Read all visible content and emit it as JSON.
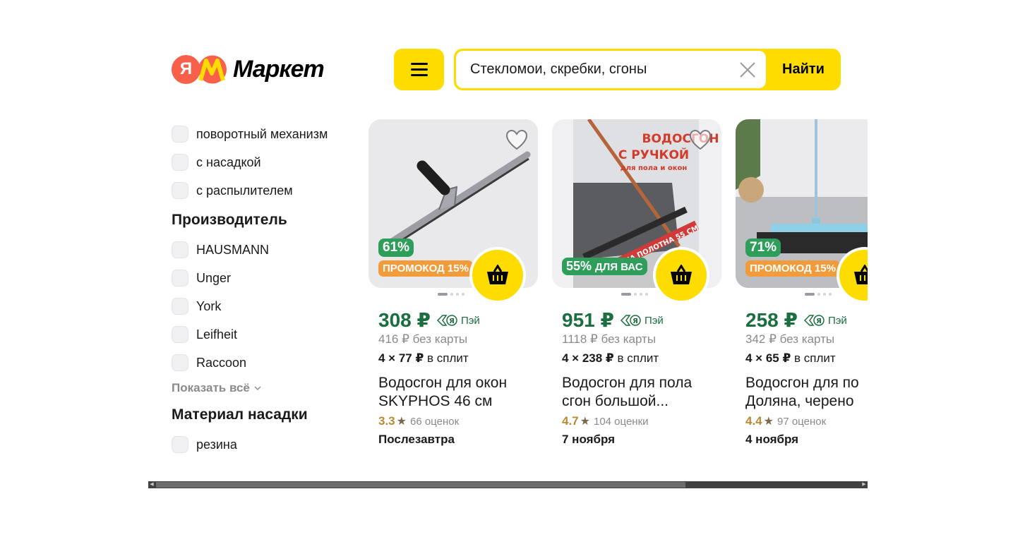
{
  "header": {
    "logo_letter": "Я",
    "logo_text": "Маркет",
    "search_value": "Стекломои, скребки, сгоны",
    "find_label": "Найти"
  },
  "filters": {
    "features": [
      "поворотный механизм",
      "с насадкой",
      "с распылителем"
    ],
    "manufacturer_title": "Производитель",
    "manufacturers": [
      "HAUSMANN",
      "Unger",
      "York",
      "Leifheit",
      "Raccoon"
    ],
    "show_all": "Показать всё",
    "material_title": "Материал насадки",
    "materials": [
      "резина"
    ]
  },
  "products": [
    {
      "discount": "61%",
      "promo": "ПРОМОКОД 15%",
      "price": "308 ₽",
      "pay_label": "Пэй",
      "old_price": "416 ₽ без карты",
      "split_amount": "4 × 77 ₽",
      "split_label": "в сплит",
      "title_line1": "Водосгон для окон",
      "title_line2": "SKYPHOS 46 см",
      "rating": "3.3",
      "reviews": "66 оценок",
      "delivery": "Послезавтра"
    },
    {
      "discount": "55%",
      "discount_note": "ДЛЯ ВАС",
      "image_text_1": "ВОДОСГОН",
      "image_text_2": "С РУЧКОЙ",
      "image_text_3": "для пола и окон",
      "image_text_4": "ШИРИНА ПОЛОТНА 55 СМ",
      "price": "951 ₽",
      "pay_label": "Пэй",
      "old_price": "1118 ₽ без карты",
      "split_amount": "4 × 238 ₽",
      "split_label": "в сплит",
      "title_line1": "Водосгон для пола",
      "title_line2": "сгон большой...",
      "rating": "4.7",
      "reviews": "104 оценки",
      "delivery": "7 ноября"
    },
    {
      "discount": "71%",
      "promo": "ПРОМОКОД 15%",
      "price": "258 ₽",
      "pay_label": "Пэй",
      "old_price": "342 ₽ без карты",
      "split_amount": "4 × 65 ₽",
      "split_label": "в сплит",
      "title_line1": "Водосгон для по",
      "title_line2": "Доляна, черено",
      "rating": "4.4",
      "reviews": "97 оценок",
      "delivery": "4 ноября"
    }
  ],
  "colors": {
    "brand_yellow": "#ffdc00",
    "price_green": "#1b6e3f",
    "discount_green": "#2f9e5b",
    "promo_orange": "#f29b3b",
    "logo_red": "#f8604a"
  }
}
